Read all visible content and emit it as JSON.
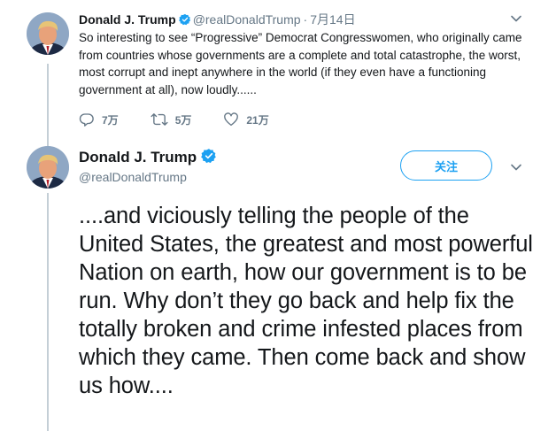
{
  "tweet1": {
    "name": "Donald J. Trump",
    "handle": "@realDonaldTrump",
    "separator": "·",
    "date": "7月14日",
    "text": "So interesting to see “Progressive” Democrat Congresswomen, who originally came from countries whose governments are a complete and total catastrophe, the worst, most corrupt and inept anywhere in the world (if they even have a functioning government at all), now loudly......",
    "replies": "7万",
    "retweets": "5万",
    "likes": "21万"
  },
  "tweet2": {
    "name": "Donald J. Trump",
    "handle": "@realDonaldTrump",
    "follow_label": "关注",
    "text": "....and viciously telling the people of the United States, the greatest and most powerful Nation on earth, how our government is to be run. Why don’t they go back and help fix the totally broken and crime infested places from which they came. Then come back and show us how...."
  },
  "colors": {
    "accent": "#1da1f2",
    "secondary_text": "#657786",
    "thread_line": "#c4cfd6"
  },
  "icons": [
    "verified-badge-icon",
    "caret-down-icon",
    "reply-icon",
    "retweet-icon",
    "like-icon"
  ]
}
